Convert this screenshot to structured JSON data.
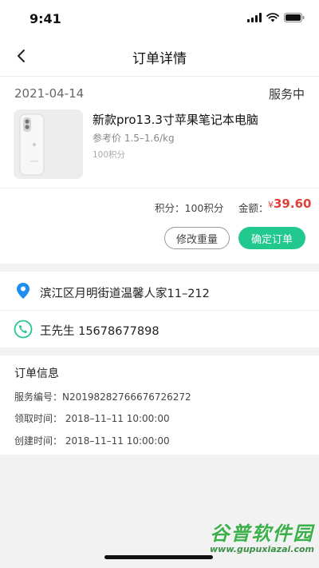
{
  "status": {
    "time": "9:41"
  },
  "nav": {
    "title": "订单详情"
  },
  "order": {
    "date": "2021-04-14",
    "status": "服务中",
    "product_title": "新款pro13.3寸苹果笔记本电脑",
    "ref_price": "参考价 1.5–1.6/kg",
    "points_small": "100积分",
    "points_summary": "积分：100积分",
    "amount_label": "金额：",
    "amount_currency": "¥",
    "amount_value": "39.60",
    "btn_edit_weight": "修改重量",
    "btn_confirm": "确定订单"
  },
  "address": {
    "text": "滨江区月明街道温馨人家11–212"
  },
  "contact": {
    "text": "王先生 15678677898"
  },
  "info": {
    "title": "订单信息",
    "service_no": "服务编号：N20198282766676726272",
    "pickup_time": "领取时间：  2018–11–11 10:00:00",
    "created_time": "创建时间：  2018–11–11 10:00:00"
  },
  "watermark": {
    "main": "谷普软件园",
    "url": "www.gupuxiazai.com"
  },
  "colors": {
    "accent": "#22c98f",
    "price": "#e0403a",
    "location_pin": "#1e8ff0"
  }
}
